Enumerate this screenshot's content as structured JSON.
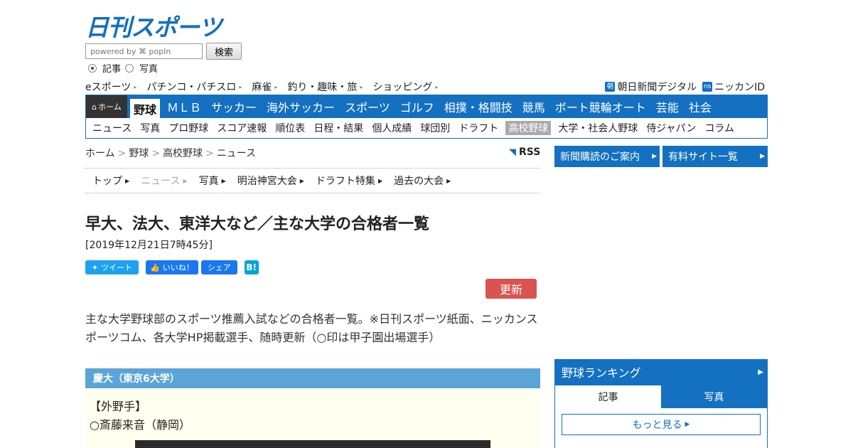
{
  "header": {
    "logo_text": "日刊スポーツ",
    "search": {
      "placeholder": "powered by ⌘ popIn",
      "button": "検索"
    },
    "radio": [
      {
        "label": "記事",
        "checked": true
      },
      {
        "label": "写真",
        "checked": false
      }
    ]
  },
  "util_links": {
    "left": [
      "eスポーツ",
      "パチンコ・パチスロ",
      "麻雀",
      "釣り・趣味・旅",
      "ショッピング"
    ],
    "right": [
      {
        "badge": "朝",
        "label": "朝日新聞デジタル"
      },
      {
        "badge": "ns",
        "label": "ニッカンID"
      }
    ]
  },
  "nav": {
    "home": "ホーム",
    "main": [
      "野球",
      "ＭＬＢ",
      "サッカー",
      "海外サッカー",
      "スポーツ",
      "ゴルフ",
      "相撲・格闘技",
      "競馬",
      "ボート競輪オート",
      "芸能",
      "社会"
    ],
    "main_active": "野球",
    "sub": [
      "ニュース",
      "写真",
      "プロ野球",
      "スコア速報",
      "順位表",
      "日程・結果",
      "個人成績",
      "球団別",
      "ドラフト",
      "高校野球",
      "大学・社会人野球",
      "侍ジャパン",
      "コラム"
    ],
    "sub_active": "高校野球"
  },
  "breadcrumb": [
    "ホーム",
    "野球",
    "高校野球",
    "ニュース"
  ],
  "rss_label": "RSS",
  "subtabs": [
    "トップ",
    "ニュース",
    "写真",
    "明治神宮大会",
    "ドラフト特集",
    "過去の大会"
  ],
  "subtab_active": "ニュース",
  "article": {
    "title": "早大、法大、東洋大など／主な大学の合格者一覧",
    "date": "[2019年12月21日7時45分]",
    "share": {
      "tweet": "ツイート",
      "like": "いいね！",
      "share": "シェア",
      "hatena": "B!"
    },
    "update_button": "更新",
    "lead": "主な大学野球部のスポーツ推薦入試などの合格者一覧。※日刊スポーツ紙面、ニッカンスポーツコム、各大学HP掲載選手、随時更新（○印は甲子園出場選手）",
    "section_title": "慶大（東京6大学）",
    "section_lines": [
      "【外野手】",
      "○斎藤来音（静岡）"
    ]
  },
  "sidebar": {
    "buttons": [
      "新聞購読のご案内",
      "有料サイト一覧"
    ],
    "ranking_title": "野球ランキング",
    "ranking_tabs": [
      "記事",
      "写真"
    ],
    "more": "もっと見る"
  },
  "colors": {
    "brand_blue": "#1470c0",
    "section_blue": "#5ba4d8",
    "update_red": "#d9534f",
    "twitter": "#1da1f2",
    "facebook": "#1877f2"
  }
}
